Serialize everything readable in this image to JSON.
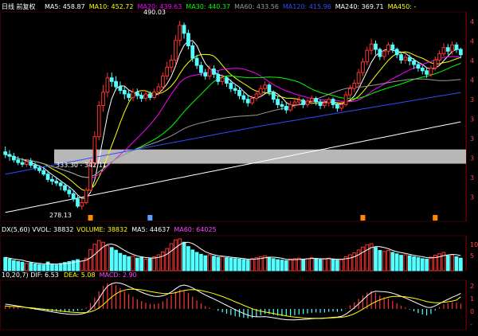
{
  "header": {
    "title": "日线 前复权",
    "ma_items": [
      {
        "label": "MA5: 458.87",
        "color": "#ffffff"
      },
      {
        "label": "MA10: 452.72",
        "color": "#ffff00"
      },
      {
        "label": "MA20: 439.63",
        "color": "#ff00ff"
      },
      {
        "label": "MA30: 440.37",
        "color": "#00ff00"
      },
      {
        "label": "MA60: 433.56",
        "color": "#9a9a9a"
      },
      {
        "label": "MA120: 415.96",
        "color": "#2f4cff"
      },
      {
        "label": "MA240: 369.71",
        "color": "#ffffff"
      },
      {
        "label": "MA450: -",
        "color": "#ffff00"
      }
    ]
  },
  "annotations": {
    "high": "490.03",
    "low": "278.13",
    "band": "333.30 - 342.11"
  },
  "price_axis_labels": [
    "4",
    "4",
    "4",
    "4",
    "3",
    "3",
    "3",
    "3",
    "3",
    "3"
  ],
  "volume_header": {
    "label": "DX(5,60)  VVOL: 38832",
    "items": [
      {
        "label": "VOLUME: 38832",
        "color": "#ffff00"
      },
      {
        "label": "MA5: 44637",
        "color": "#ffffff"
      },
      {
        "label": "MA60: 64025",
        "color": "#ff44ff"
      }
    ]
  },
  "volume_axis_labels": [
    "10",
    "5"
  ],
  "macd_header": {
    "label": "10,20,7)  DIF: 6.53",
    "items": [
      {
        "label": "DEA: 5.08",
        "color": "#ffff00"
      },
      {
        "label": "MACD: 2.90",
        "color": "#ff44ff"
      }
    ]
  },
  "macd_axis_labels": [
    "2",
    "1",
    "0",
    "-"
  ],
  "colors": {
    "up": "#ff3333",
    "down": "#54ffff",
    "grid": "#3a0000",
    "ma5": "#ffffff",
    "ma10": "#ffff00",
    "ma20": "#ff00ff",
    "ma30": "#00ff00",
    "ma60": "#9a9a9a",
    "ma120": "#2f4cff",
    "ma240": "#ffffff",
    "dif": "#ffffff",
    "dea": "#ffff00",
    "band": "#d0d0d0"
  },
  "chart_data": {
    "type": "candlestick",
    "price_range": [
      265,
      500
    ],
    "band_range": [
      333.3,
      342.11
    ],
    "high": 490.03,
    "low": 278.13,
    "candles": [
      [
        343,
        340,
        349,
        336
      ],
      [
        340,
        338,
        345,
        333
      ],
      [
        338,
        334,
        342,
        331
      ],
      [
        334,
        331,
        338,
        328
      ],
      [
        331,
        329,
        336,
        326
      ],
      [
        329,
        332,
        335,
        326
      ],
      [
        332,
        328,
        336,
        325
      ],
      [
        328,
        325,
        331,
        322
      ],
      [
        325,
        322,
        328,
        319
      ],
      [
        322,
        318,
        326,
        316
      ],
      [
        318,
        312,
        322,
        309
      ],
      [
        312,
        310,
        316,
        306
      ],
      [
        310,
        308,
        314,
        305
      ],
      [
        308,
        305,
        311,
        300
      ],
      [
        305,
        300,
        308,
        298
      ],
      [
        300,
        296,
        304,
        292
      ],
      [
        296,
        290,
        300,
        287
      ],
      [
        290,
        282,
        294,
        280
      ],
      [
        282,
        286,
        290,
        278
      ],
      [
        286,
        300,
        303,
        284
      ],
      [
        300,
        330,
        334,
        298
      ],
      [
        330,
        360,
        366,
        326
      ],
      [
        360,
        395,
        400,
        356
      ],
      [
        395,
        410,
        418,
        388
      ],
      [
        410,
        426,
        432,
        404
      ],
      [
        426,
        422,
        432,
        416
      ],
      [
        422,
        416,
        428,
        412
      ],
      [
        416,
        412,
        422,
        408
      ],
      [
        412,
        408,
        416,
        402
      ],
      [
        408,
        404,
        412,
        400
      ],
      [
        404,
        410,
        414,
        400
      ],
      [
        410,
        406,
        414,
        402
      ],
      [
        406,
        403,
        410,
        399
      ],
      [
        403,
        408,
        412,
        400
      ],
      [
        408,
        404,
        411,
        401
      ],
      [
        404,
        410,
        414,
        402
      ],
      [
        410,
        416,
        420,
        406
      ],
      [
        416,
        428,
        432,
        412
      ],
      [
        428,
        438,
        444,
        424
      ],
      [
        438,
        446,
        452,
        432
      ],
      [
        446,
        468,
        474,
        440
      ],
      [
        468,
        485,
        490,
        462
      ],
      [
        485,
        476,
        488,
        470
      ],
      [
        476,
        462,
        480,
        458
      ],
      [
        462,
        448,
        466,
        444
      ],
      [
        448,
        440,
        452,
        436
      ],
      [
        440,
        432,
        444,
        428
      ],
      [
        432,
        428,
        436,
        424
      ],
      [
        428,
        436,
        440,
        424
      ],
      [
        436,
        430,
        440,
        426
      ],
      [
        430,
        422,
        434,
        418
      ],
      [
        422,
        426,
        430,
        418
      ],
      [
        426,
        420,
        428,
        416
      ],
      [
        420,
        414,
        424,
        410
      ],
      [
        414,
        412,
        418,
        408
      ],
      [
        412,
        406,
        416,
        402
      ],
      [
        406,
        402,
        410,
        398
      ],
      [
        402,
        398,
        406,
        394
      ],
      [
        398,
        403,
        406,
        396
      ],
      [
        403,
        408,
        412,
        400
      ],
      [
        408,
        414,
        418,
        404
      ],
      [
        414,
        418,
        422,
        410
      ],
      [
        418,
        410,
        420,
        406
      ],
      [
        410,
        402,
        412,
        398
      ],
      [
        402,
        396,
        406,
        392
      ],
      [
        396,
        394,
        400,
        390
      ],
      [
        394,
        390,
        398,
        386
      ],
      [
        390,
        396,
        400,
        388
      ],
      [
        396,
        399,
        402,
        392
      ],
      [
        399,
        401,
        405,
        395
      ],
      [
        401,
        396,
        403,
        392
      ],
      [
        396,
        400,
        403,
        393
      ],
      [
        400,
        403,
        406,
        396
      ],
      [
        403,
        399,
        405,
        395
      ],
      [
        399,
        395,
        402,
        391
      ],
      [
        395,
        398,
        401,
        392
      ],
      [
        398,
        402,
        404,
        394
      ],
      [
        402,
        396,
        404,
        392
      ],
      [
        396,
        392,
        398,
        388
      ],
      [
        392,
        396,
        400,
        389
      ],
      [
        396,
        407,
        411,
        394
      ],
      [
        407,
        414,
        418,
        403
      ],
      [
        414,
        420,
        424,
        410
      ],
      [
        420,
        432,
        436,
        416
      ],
      [
        432,
        444,
        448,
        428
      ],
      [
        444,
        457,
        461,
        440
      ],
      [
        457,
        464,
        470,
        452
      ],
      [
        464,
        458,
        468,
        452
      ],
      [
        458,
        450,
        460,
        446
      ],
      [
        450,
        456,
        458,
        446
      ],
      [
        456,
        463,
        466,
        452
      ],
      [
        463,
        458,
        466,
        454
      ],
      [
        458,
        452,
        460,
        448
      ],
      [
        452,
        446,
        455,
        442
      ],
      [
        446,
        449,
        452,
        442
      ],
      [
        449,
        445,
        452,
        440
      ],
      [
        445,
        441,
        448,
        436
      ],
      [
        441,
        437,
        444,
        433
      ],
      [
        437,
        434,
        440,
        430
      ],
      [
        434,
        430,
        437,
        426
      ],
      [
        430,
        437,
        440,
        427
      ],
      [
        437,
        446,
        450,
        434
      ],
      [
        446,
        453,
        457,
        442
      ],
      [
        453,
        460,
        465,
        450
      ],
      [
        460,
        456,
        464,
        452
      ],
      [
        456,
        463,
        467,
        452
      ],
      [
        463,
        458,
        466,
        454
      ],
      [
        458,
        452,
        460,
        448
      ]
    ],
    "volumes": [
      55,
      48,
      42,
      38,
      35,
      30,
      32,
      28,
      26,
      24,
      36,
      28,
      24,
      30,
      34,
      38,
      42,
      46,
      40,
      52,
      88,
      110,
      125,
      118,
      104,
      96,
      85,
      72,
      64,
      58,
      60,
      52,
      55,
      48,
      50,
      58,
      66,
      78,
      92,
      112,
      128,
      132,
      118,
      100,
      86,
      76,
      68,
      62,
      66,
      60,
      56,
      58,
      54,
      52,
      50,
      48,
      46,
      44,
      50,
      54,
      58,
      62,
      56,
      50,
      46,
      44,
      42,
      48,
      50,
      52,
      48,
      50,
      54,
      50,
      46,
      48,
      52,
      48,
      44,
      46,
      58,
      66,
      74,
      86,
      98,
      108,
      112,
      96,
      84,
      80,
      84,
      76,
      70,
      64,
      66,
      62,
      58,
      54,
      50,
      48,
      56,
      64,
      70,
      76,
      62,
      66,
      58,
      52
    ],
    "macd": [
      1.5,
      1.2,
      0.9,
      0.6,
      0.3,
      0.1,
      -0.1,
      -0.3,
      -0.5,
      -0.7,
      -0.9,
      -1.0,
      -1.1,
      -1.2,
      -1.3,
      -1.2,
      -1.0,
      -0.8,
      -0.4,
      0.5,
      2.4,
      4.8,
      7.4,
      9.6,
      10.8,
      10.6,
      9.9,
      8.7,
      7.4,
      6.2,
      5.1,
      4.1,
      3.3,
      2.6,
      2.1,
      2.0,
      2.3,
      3.2,
      4.4,
      5.8,
      7.3,
      8.2,
      7.8,
      6.6,
      5.1,
      3.6,
      2.3,
      1.2,
      0.5,
      -0.1,
      -0.8,
      -1.4,
      -2.0,
      -2.6,
      -3.1,
      -3.4,
      -3.7,
      -3.9,
      -3.8,
      -3.3,
      -2.7,
      -2.1,
      -2.2,
      -2.5,
      -2.8,
      -3.0,
      -3.1,
      -2.9,
      -2.6,
      -2.3,
      -2.1,
      -1.9,
      -1.6,
      -1.5,
      -1.6,
      -1.5,
      -1.2,
      -1.1,
      -1.2,
      -0.9,
      0.2,
      1.5,
      2.8,
      4.2,
      5.6,
      6.9,
      7.5,
      6.8,
      5.6,
      4.9,
      4.3,
      3.4,
      2.4,
      1.3,
      0.6,
      -0.2,
      -1.0,
      -1.7,
      -2.3,
      -2.7,
      -2.1,
      -0.6,
      0.8,
      2.0,
      2.3,
      2.8,
      2.6,
      2.2
    ],
    "dif": [
      2,
      1.8,
      1.5,
      1.2,
      0.9,
      0.6,
      0.3,
      0,
      -0.3,
      -0.6,
      -0.9,
      -1.2,
      -1.5,
      -1.8,
      -2.0,
      -2.2,
      -2.3,
      -2.3,
      -2.1,
      -1.6,
      -0.3,
      1.8,
      4.4,
      7.2,
      9.5,
      10.6,
      11.0,
      10.8,
      10.2,
      9.4,
      8.6,
      7.8,
      7.0,
      6.3,
      5.7,
      5.3,
      5.2,
      5.5,
      6.1,
      7.1,
      8.4,
      9.6,
      10.0,
      9.6,
      8.8,
      7.8,
      6.8,
      5.8,
      5.0,
      4.2,
      3.3,
      2.4,
      1.5,
      0.6,
      -0.3,
      -1.1,
      -1.9,
      -2.6,
      -3.1,
      -3.3,
      -3.3,
      -3.2,
      -3.4,
      -3.7,
      -4.0,
      -4.3,
      -4.5,
      -4.6,
      -4.6,
      -4.5,
      -4.4,
      -4.3,
      -4.1,
      -4.0,
      -4.0,
      -3.9,
      -3.7,
      -3.5,
      -3.4,
      -3.1,
      -2.2,
      -0.9,
      0.5,
      2.1,
      3.8,
      5.5,
      6.9,
      7.4,
      7.3,
      7.2,
      7.0,
      6.6,
      6.0,
      5.3,
      4.6,
      3.8,
      3.0,
      2.2,
      1.4,
      0.7,
      0.6,
      1.3,
      2.2,
      3.2,
      4.0,
      4.9,
      5.6,
      6.5
    ],
    "dea": [
      1.2,
      1.1,
      1.0,
      0.9,
      0.8,
      0.6,
      0.5,
      0.3,
      0.1,
      -0.1,
      -0.3,
      -0.5,
      -0.7,
      -0.9,
      -1.1,
      -1.3,
      -1.4,
      -1.5,
      -1.6,
      -1.5,
      -1.2,
      -0.6,
      0.4,
      1.8,
      3.4,
      5.0,
      6.3,
      7.3,
      7.9,
      8.2,
      8.3,
      8.2,
      8.0,
      7.7,
      7.3,
      7.0,
      6.7,
      6.5,
      6.4,
      6.5,
      6.8,
      7.3,
      7.7,
      8.0,
      8.1,
      8.0,
      7.7,
      7.3,
      6.9,
      6.4,
      5.8,
      5.2,
      4.5,
      3.8,
      3.0,
      2.3,
      1.5,
      0.8,
      0.1,
      -0.5,
      -0.9,
      -1.3,
      -1.6,
      -1.9,
      -2.3,
      -2.6,
      -2.9,
      -3.2,
      -3.4,
      -3.6,
      -3.8,
      -3.9,
      -3.9,
      -3.9,
      -3.9,
      -3.8,
      -3.8,
      -3.7,
      -3.6,
      -3.5,
      -3.2,
      -2.7,
      -2.0,
      -1.1,
      -0.1,
      1.0,
      2.1,
      3.0,
      3.8,
      4.4,
      4.9,
      5.2,
      5.3,
      5.2,
      5.1,
      4.8,
      4.5,
      4.1,
      3.6,
      3.1,
      2.8,
      2.6,
      2.6,
      2.8,
      3.0,
      3.3,
      3.7,
      5.1
    ]
  }
}
